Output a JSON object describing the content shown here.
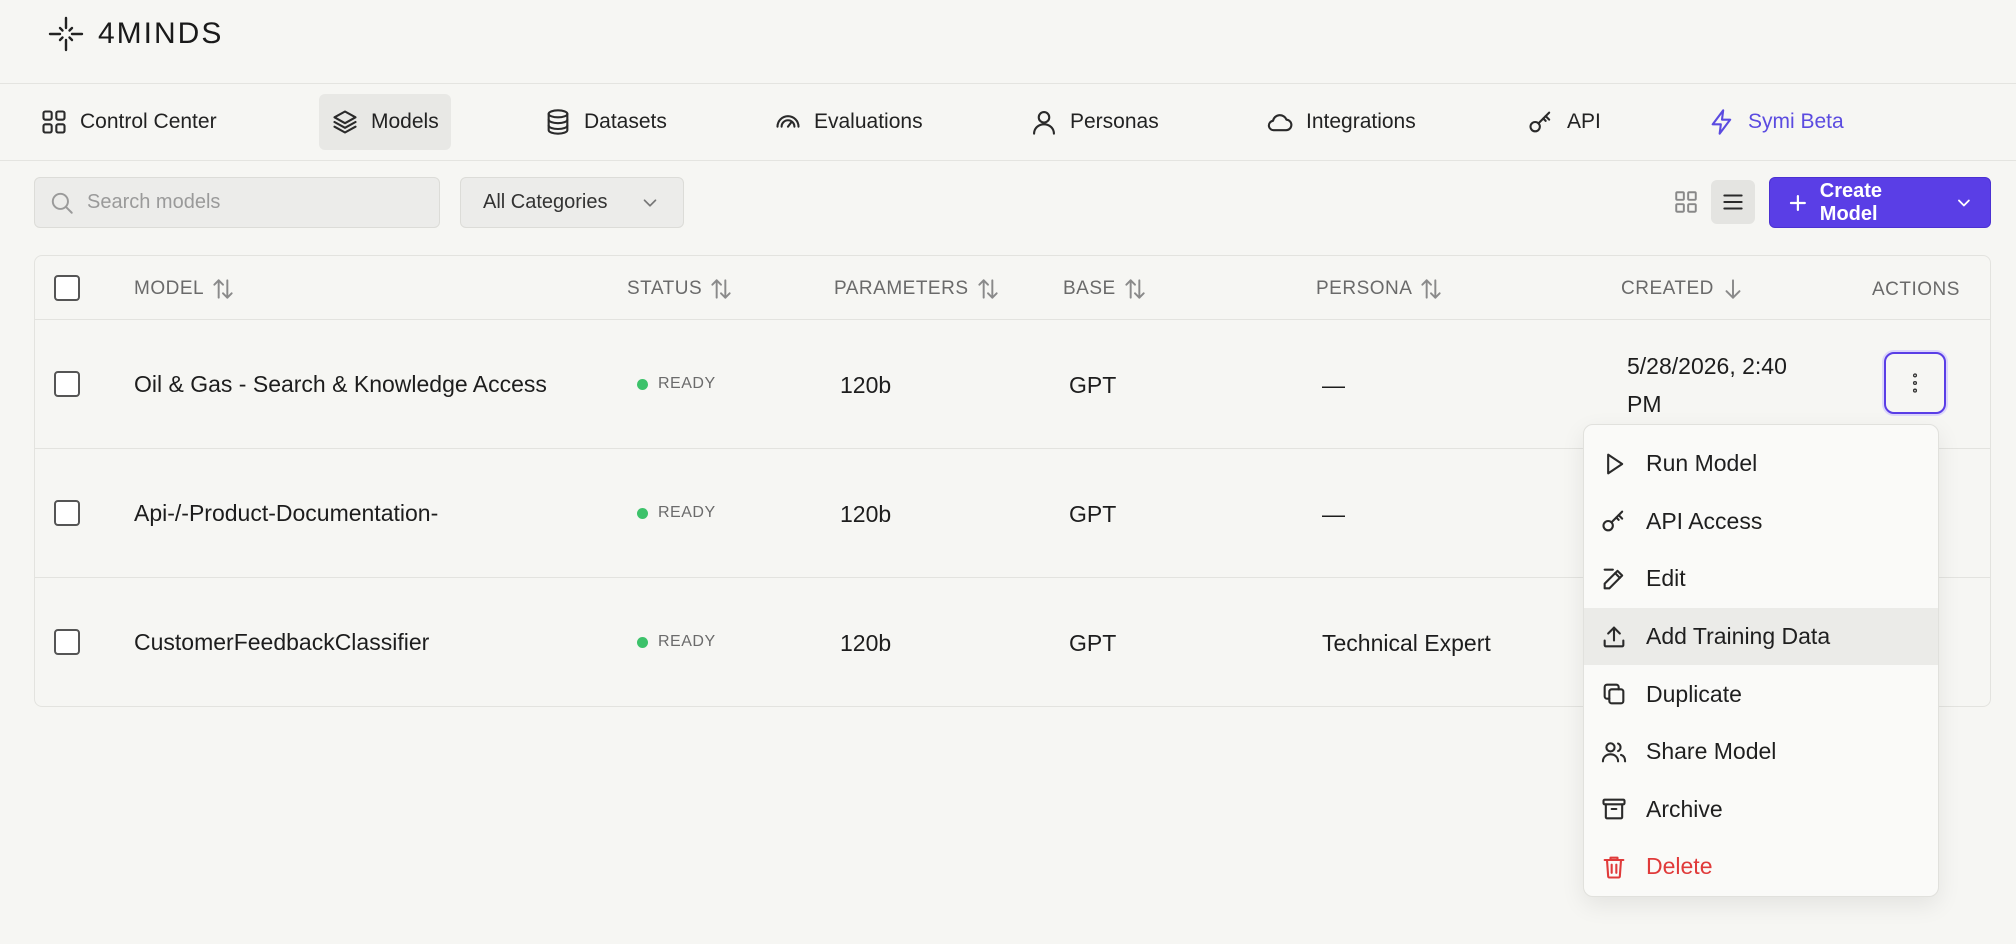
{
  "brand": {
    "name": "4MINDS",
    "icon": "sparkle-logo-icon"
  },
  "nav": {
    "items": [
      {
        "label": "Control Center",
        "icon": "grid-icon",
        "active": false
      },
      {
        "label": "Models",
        "icon": "layers-icon",
        "active": true
      },
      {
        "label": "Datasets",
        "icon": "database-icon",
        "active": false
      },
      {
        "label": "Evaluations",
        "icon": "gauge-icon",
        "active": false
      },
      {
        "label": "Personas",
        "icon": "user-icon",
        "active": false
      },
      {
        "label": "Integrations",
        "icon": "cloud-icon",
        "active": false
      },
      {
        "label": "API",
        "icon": "key-icon",
        "active": false
      },
      {
        "label": "Symi Beta",
        "icon": "bolt-icon",
        "active": false
      }
    ],
    "beta_color": "#5b4be0"
  },
  "toolbar": {
    "search_placeholder": "Search models",
    "category_selected": "All Categories",
    "create_label": "Create Model",
    "accent": "#5a3ee6"
  },
  "table": {
    "headers": {
      "model": "MODEL",
      "status": "STATUS",
      "parameters": "PARAMETERS",
      "base": "BASE",
      "persona": "PERSONA",
      "created": "CREATED",
      "actions": "ACTIONS"
    },
    "rows": [
      {
        "model": "Oil & Gas - Search & Knowledge Access",
        "status": "READY",
        "parameters": "120b",
        "base": "GPT",
        "persona": "—",
        "created_line1": "5/28/2026, 2:40",
        "created_line2": "PM"
      },
      {
        "model": "Api-/-Product-Documentation-",
        "status": "READY",
        "parameters": "120b",
        "base": "GPT",
        "persona": "—"
      },
      {
        "model": "CustomerFeedbackClassifier",
        "status": "READY",
        "parameters": "120b",
        "base": "GPT",
        "persona": "Technical Expert"
      }
    ],
    "status_color": "#3cc26a"
  },
  "menu": {
    "items": [
      {
        "label": "Run Model",
        "icon": "play-icon"
      },
      {
        "label": "API Access",
        "icon": "key-icon"
      },
      {
        "label": "Edit",
        "icon": "edit-icon"
      },
      {
        "label": "Add Training Data",
        "icon": "upload-icon"
      },
      {
        "label": "Duplicate",
        "icon": "copy-icon"
      },
      {
        "label": "Share Model",
        "icon": "users-icon"
      },
      {
        "label": "Archive",
        "icon": "archive-icon"
      },
      {
        "label": "Delete",
        "icon": "trash-icon"
      }
    ],
    "danger_color": "#e03a3a"
  }
}
